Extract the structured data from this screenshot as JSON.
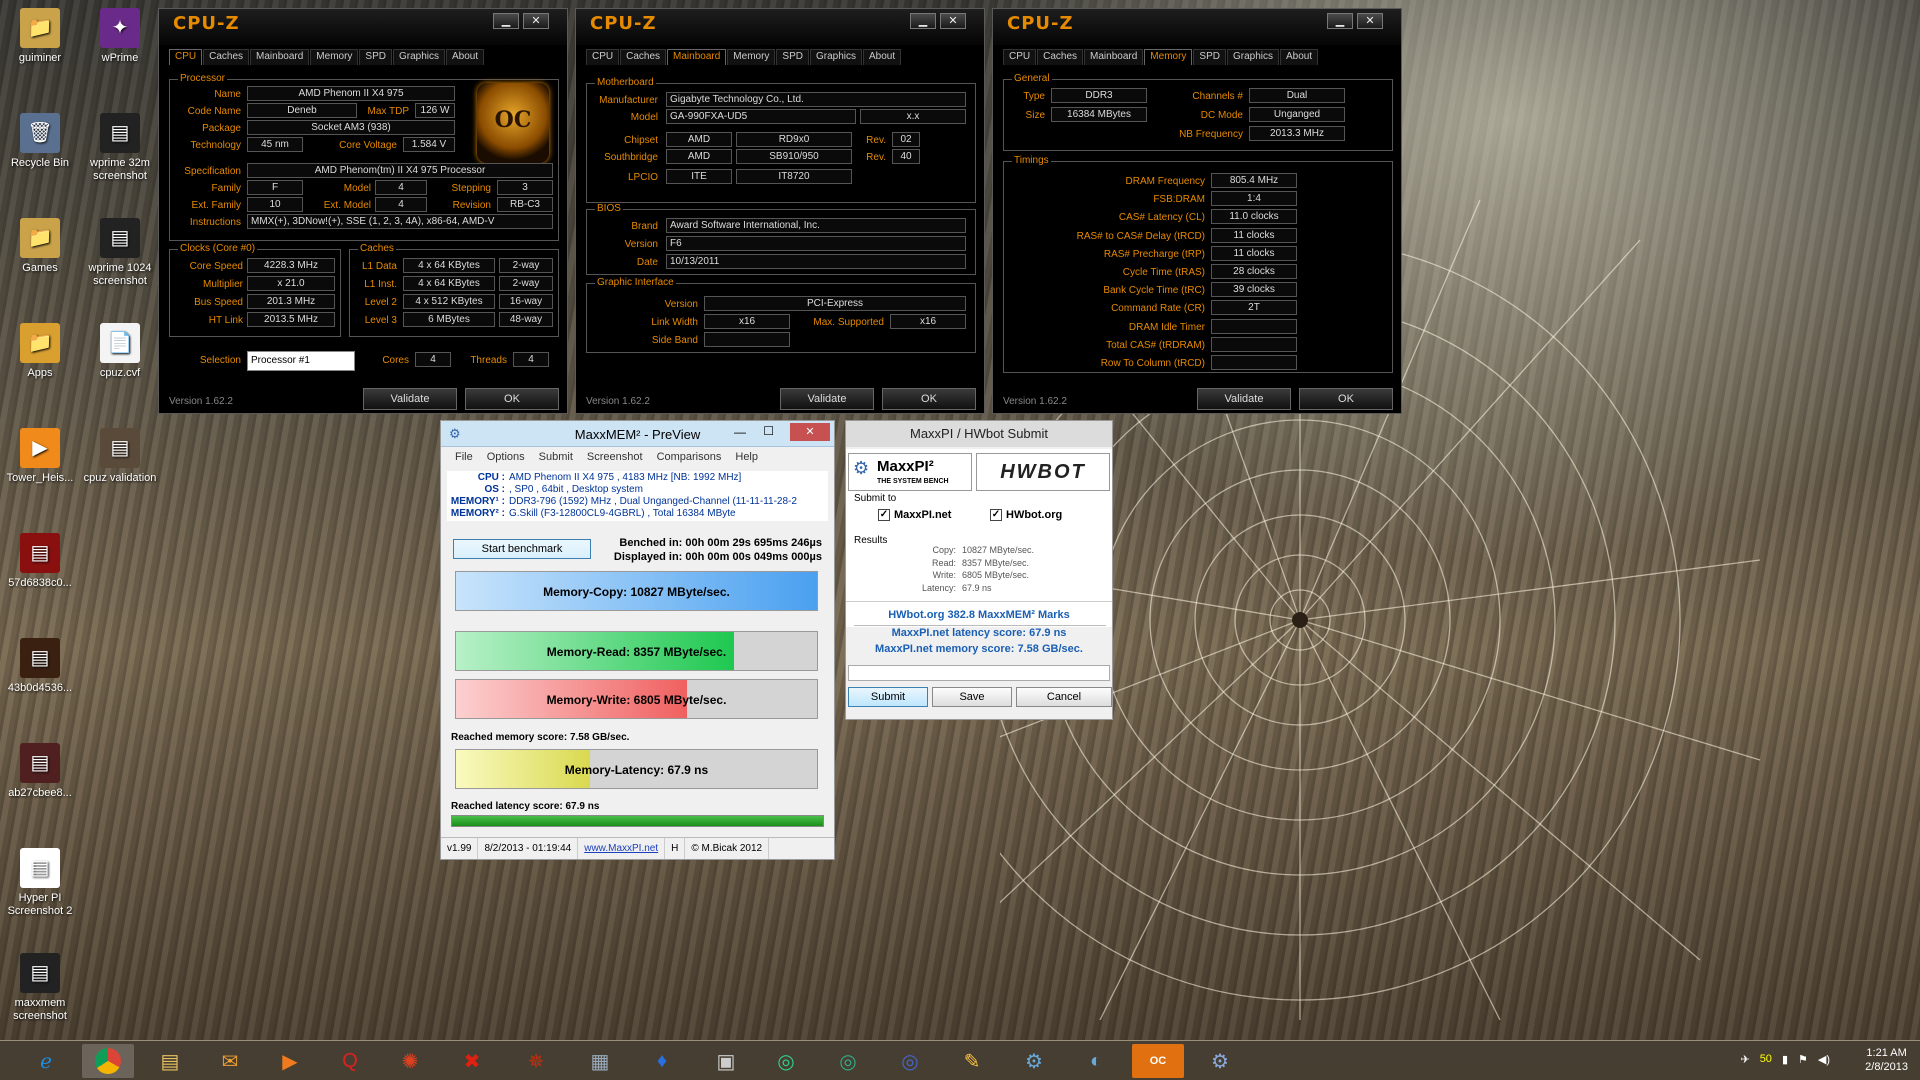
{
  "desktop": {
    "icons": [
      {
        "label": "guiminer",
        "color": "#c9a24a",
        "glyph": "📁"
      },
      {
        "label": "wPrime",
        "color": "#6a2a8a",
        "glyph": "✦"
      },
      {
        "label": "Recycle Bin",
        "color": "#5a7090",
        "glyph": "🗑"
      },
      {
        "label": "wprime 32m screenshot",
        "color": "#222",
        "glyph": "▤"
      },
      {
        "label": "Games",
        "color": "#c9a24a",
        "glyph": "📁"
      },
      {
        "label": "wprime 1024 screenshot",
        "color": "#222",
        "glyph": "▤"
      },
      {
        "label": "Apps",
        "color": "#d9a030",
        "glyph": "📁"
      },
      {
        "label": "cpuz.cvf",
        "color": "#f4f4f4",
        "glyph": "📄"
      },
      {
        "label": "Tower_Heis...",
        "color": "#f08a1a",
        "glyph": "▶"
      },
      {
        "label": "cpuz validation",
        "color": "#5a4a3a",
        "glyph": "▤"
      },
      {
        "label": "57d6838c0...",
        "color": "#8a1010",
        "glyph": "▤"
      },
      {
        "label": "43b0d4536...",
        "color": "#3a2010",
        "glyph": "▤"
      },
      {
        "label": "ab27cbee8...",
        "color": "#502020",
        "glyph": "▤"
      },
      {
        "label": "Hyper PI Screenshot 2",
        "color": "#fff",
        "glyph": "▤"
      },
      {
        "label": "maxxmem screenshot",
        "color": "#222",
        "glyph": "▤"
      }
    ]
  },
  "cpuz_common": {
    "app_name": "CPU-Z",
    "version": "Version 1.62.2",
    "validate": "Validate",
    "ok": "OK",
    "minimize": "▁",
    "close": "✕",
    "tabs": [
      "CPU",
      "Caches",
      "Mainboard",
      "Memory",
      "SPD",
      "Graphics",
      "About"
    ]
  },
  "cpuz_cpu": {
    "active_tab": "CPU",
    "oc_badge": "OC",
    "processor_title": "Processor",
    "name_lbl": "Name",
    "name": "AMD Phenom II X4 975",
    "codename_lbl": "Code Name",
    "codename": "Deneb",
    "maxtdp_lbl": "Max TDP",
    "maxtdp": "126 W",
    "package_lbl": "Package",
    "package": "Socket AM3 (938)",
    "tech_lbl": "Technology",
    "tech": "45 nm",
    "cv_lbl": "Core Voltage",
    "cv": "1.584 V",
    "spec_lbl": "Specification",
    "spec": "AMD Phenom(tm) II X4 975 Processor",
    "family_lbl": "Family",
    "family": "F",
    "model_lbl": "Model",
    "model": "4",
    "stepping_lbl": "Stepping",
    "stepping": "3",
    "extfam_lbl": "Ext. Family",
    "extfam": "10",
    "extmod_lbl": "Ext. Model",
    "extmod": "4",
    "rev_lbl": "Revision",
    "rev": "RB-C3",
    "instr_lbl": "Instructions",
    "instr": "MMX(+), 3DNow!(+), SSE (1, 2, 3, 4A), x86-64, AMD-V",
    "clocks_title": "Clocks (Core #0)",
    "corespeed_lbl": "Core Speed",
    "corespeed": "4228.3 MHz",
    "mult_lbl": "Multiplier",
    "mult": "x 21.0",
    "bus_lbl": "Bus Speed",
    "bus": "201.3 MHz",
    "ht_lbl": "HT Link",
    "ht": "2013.5 MHz",
    "caches_title": "Caches",
    "l1d_lbl": "L1 Data",
    "l1d": "4 x 64 KBytes",
    "l1d_w": "2-way",
    "l1i_lbl": "L1 Inst.",
    "l1i": "4 x 64 KBytes",
    "l1i_w": "2-way",
    "l2_lbl": "Level 2",
    "l2": "4 x 512 KBytes",
    "l2_w": "16-way",
    "l3_lbl": "Level 3",
    "l3": "6 MBytes",
    "l3_w": "48-way",
    "sel_lbl": "Selection",
    "sel": "Processor #1",
    "cores_lbl": "Cores",
    "cores": "4",
    "threads_lbl": "Threads",
    "threads": "4"
  },
  "cpuz_mb": {
    "active_tab": "Mainboard",
    "mb_title": "Motherboard",
    "manu_lbl": "Manufacturer",
    "manu": "Gigabyte Technology Co., Ltd.",
    "model_lbl": "Model",
    "model": "GA-990FXA-UD5",
    "model2": "x.x",
    "chipset_lbl": "Chipset",
    "chipset1": "AMD",
    "chipset2": "RD9x0",
    "rev_lbl": "Rev.",
    "chip_rev": "02",
    "sb_lbl": "Southbridge",
    "sb1": "AMD",
    "sb2": "SB910/950",
    "sb_rev": "40",
    "lpcio_lbl": "LPCIO",
    "lpcio1": "ITE",
    "lpcio2": "IT8720",
    "bios_title": "BIOS",
    "brand_lbl": "Brand",
    "brand": "Award Software International, Inc.",
    "ver_lbl": "Version",
    "ver": "F6",
    "date_lbl": "Date",
    "date": "10/13/2011",
    "gi_title": "Graphic Interface",
    "giver_lbl": "Version",
    "giver": "PCI-Express",
    "lw_lbl": "Link Width",
    "lw": "x16",
    "ms_lbl": "Max. Supported",
    "ms": "x16",
    "sband_lbl": "Side Band"
  },
  "cpuz_mem": {
    "active_tab": "Memory",
    "gen_title": "General",
    "type_lbl": "Type",
    "type": "DDR3",
    "size_lbl": "Size",
    "size": "16384 MBytes",
    "chan_lbl": "Channels #",
    "chan": "Dual",
    "dcm_lbl": "DC Mode",
    "dcm": "Unganged",
    "nbf_lbl": "NB Frequency",
    "nbf": "2013.3 MHz",
    "tim_title": "Timings",
    "timings": [
      {
        "l": "DRAM Frequency",
        "v": "805.4 MHz"
      },
      {
        "l": "FSB:DRAM",
        "v": "1:4"
      },
      {
        "l": "CAS# Latency (CL)",
        "v": "11.0 clocks"
      },
      {
        "l": "RAS# to CAS# Delay (tRCD)",
        "v": "11 clocks"
      },
      {
        "l": "RAS# Precharge (tRP)",
        "v": "11 clocks"
      },
      {
        "l": "Cycle Time (tRAS)",
        "v": "28 clocks"
      },
      {
        "l": "Bank Cycle Time (tRC)",
        "v": "39 clocks"
      },
      {
        "l": "Command Rate (CR)",
        "v": "2T"
      },
      {
        "l": "DRAM Idle Timer",
        "v": ""
      },
      {
        "l": "Total CAS# (tRDRAM)",
        "v": ""
      },
      {
        "l": "Row To Column (tRCD)",
        "v": ""
      }
    ]
  },
  "maxxmem": {
    "title": "MaxxMEM² - PreView",
    "min": "—",
    "max": "☐",
    "close": "✕",
    "menu": [
      "File",
      "Options",
      "Submit",
      "Screenshot",
      "Comparisons",
      "Help"
    ],
    "cpu_lbl": "CPU :",
    "cpu": "AMD Phenom II X4 975 , 4183 MHz  [NB: 1992 MHz]",
    "os_lbl": "OS :",
    "os": ", SP0 , 64bit , Desktop system",
    "mem1_lbl": "MEMORY¹ :",
    "mem1": "DDR3-796 (1592) MHz , Dual Unganged-Channel (11-11-11-28-2",
    "mem2_lbl": "MEMORY² :",
    "mem2": "G.Skill (F3-12800CL9-4GBRL) , Total 16384 MByte",
    "start": "Start benchmark",
    "benched": "Benched in: 00h 00m 29s 695ms 246µs",
    "displayed": "Displayed in: 00h 00m 00s 049ms 000µs",
    "copy": "Memory-Copy: 10827 MByte/sec.",
    "read": "Memory-Read: 8357 MByte/sec.",
    "write": "Memory-Write: 6805 MByte/sec.",
    "mem_score": "Reached memory score: 7.58 GB/sec.",
    "latency": "Memory-Latency: 67.9 ns",
    "lat_score": "Reached latency score: 67.9 ns",
    "copy_fill": 1.0,
    "read_fill": 0.77,
    "write_fill": 0.64,
    "latency_fill": 0.37,
    "progress_fill": 1.0,
    "ver": "v1.99",
    "stamp": "8/2/2013 - 01:19:44",
    "link": "www.MaxxPI.net",
    "h": "H",
    "copyright": "© M.Bicak 2012"
  },
  "hwbot": {
    "title": "MaxxPI / HWbot Submit",
    "logo1": "MaxxPI²",
    "logo1_sub": "THE SYSTEM BENCH",
    "logo2": "HWBOT",
    "submit_to": "Submit to",
    "opt1": "MaxxPI.net",
    "opt2": "HWbot.org",
    "results": "Results",
    "rows": [
      {
        "l": "Copy:",
        "v": "10827 MByte/sec."
      },
      {
        "l": "Read:",
        "v": "8357 MByte/sec."
      },
      {
        "l": "Write:",
        "v": "6805 MByte/sec."
      },
      {
        "l": "Latency:",
        "v": "67.9 ns"
      }
    ],
    "marks": "HWbot.org  382.8  MaxxMEM² Marks",
    "lat": "MaxxPI.net latency score:  67.9  ns",
    "mem": "MaxxPI.net memory score:  7.58  GB/sec.",
    "btn_submit": "Submit",
    "btn_save": "Save",
    "btn_cancel": "Cancel"
  },
  "taskbar": {
    "time": "1:21 AM",
    "date": "2/8/2013",
    "tray_num": "50"
  }
}
